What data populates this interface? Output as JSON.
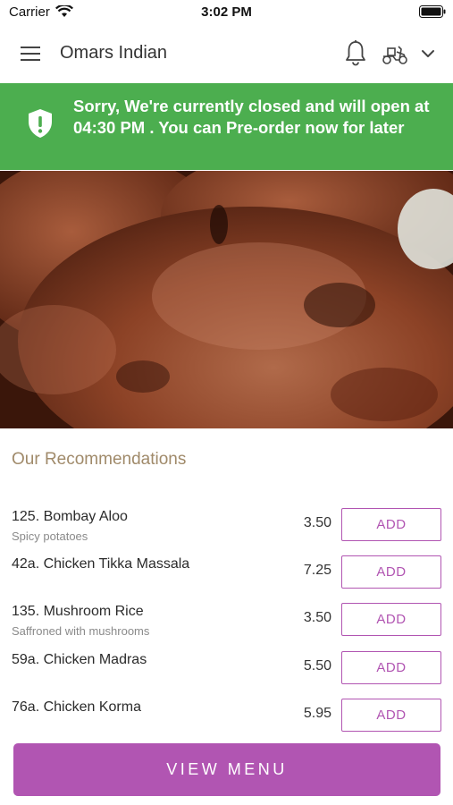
{
  "status_bar": {
    "carrier": "Carrier",
    "time": "3:02 PM"
  },
  "header": {
    "title": "Omars Indian"
  },
  "banner": {
    "message": "Sorry, We're currently closed and will open at 04:30 PM . You can Pre-order now for later"
  },
  "recommendations": {
    "title": "Our Recommendations",
    "items": [
      {
        "name": "125. Bombay Aloo",
        "description": "Spicy potatoes",
        "price": "3.50",
        "button": "ADD"
      },
      {
        "name": "42a. Chicken Tikka Massala",
        "description": "",
        "price": "7.25",
        "button": "ADD"
      },
      {
        "name": "135. Mushroom Rice",
        "description": "Saffroned with mushrooms",
        "price": "3.50",
        "button": "ADD"
      },
      {
        "name": "59a. Chicken Madras",
        "description": "",
        "price": "5.50",
        "button": "ADD"
      },
      {
        "name": "76a. Chicken Korma",
        "description": "",
        "price": "5.95",
        "button": "ADD"
      }
    ]
  },
  "footer": {
    "view_menu_label": "VIEW MENU"
  },
  "colors": {
    "accent": "#b155b2",
    "banner": "#4cae4f",
    "section_title": "#a08a6a"
  },
  "icons": [
    "wifi-icon",
    "battery-icon",
    "hamburger-menu-icon",
    "bell-icon",
    "scooter-icon",
    "chevron-down-icon",
    "shield-alert-icon"
  ]
}
